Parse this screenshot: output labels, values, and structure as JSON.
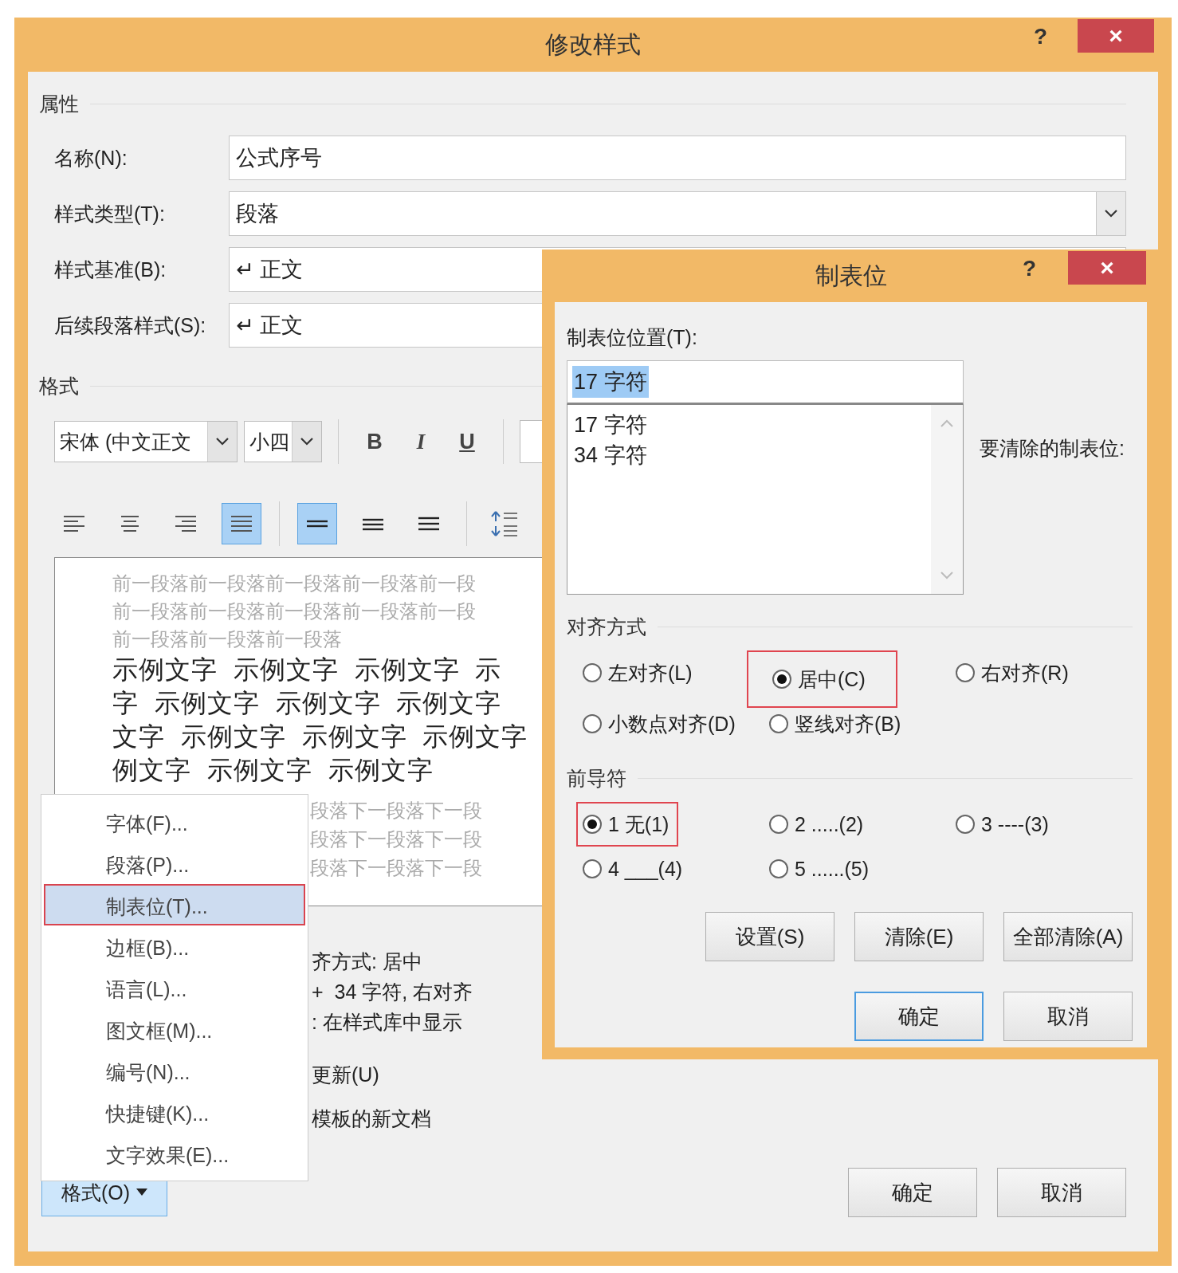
{
  "window": {
    "title": "修改样式",
    "help": "?",
    "close": "×"
  },
  "properties": {
    "heading": "属性",
    "fields": [
      {
        "label": "名称(N):",
        "value": "公式序号",
        "kind": "text"
      },
      {
        "label": "样式类型(T):",
        "value": "段落",
        "kind": "dropdown"
      },
      {
        "label": "样式基准(B):",
        "value": "↵ 正文",
        "kind": "text"
      },
      {
        "label": "后续段落样式(S):",
        "value": "↵ 正文",
        "kind": "text"
      }
    ]
  },
  "format": {
    "heading": "格式",
    "font": "宋体 (中文正文",
    "size": "小四",
    "styles": [
      {
        "label": "B",
        "kind": "bold"
      },
      {
        "label": "I",
        "kind": "italic"
      },
      {
        "label": "U",
        "kind": "underline"
      }
    ],
    "alignment": [
      {
        "kind": "left",
        "selected": false
      },
      {
        "kind": "center",
        "selected": false
      },
      {
        "kind": "right",
        "selected": false
      },
      {
        "kind": "justify",
        "selected": true
      }
    ],
    "spacing": [
      {
        "kind": "single",
        "selected": true
      },
      {
        "kind": "onehalf",
        "selected": false
      },
      {
        "kind": "double",
        "selected": false
      }
    ]
  },
  "preview": {
    "before": [
      "前一段落前一段落前一段落前一段落前一段",
      "前一段落前一段落前一段落前一段落前一段",
      "前一段落前一段落前一段落"
    ],
    "sample": [
      "示例文字  示例文字  示例文字  示",
      "字  示例文字  示例文字  示例文字",
      "文字  示例文字  示例文字  示例文字",
      "例文字  示例文字  示例文字"
    ],
    "after": [
      "段落下一段落下一段",
      "段落下一段落下一段",
      "段落下一段落下一段"
    ]
  },
  "description": [
    "齐方式: 居中",
    "+  34 字符, 右对齐",
    ": 在样式库中显示"
  ],
  "options": [
    "更新(U)",
    "模板的新文档"
  ],
  "format_button": {
    "label": "格式(O)",
    "pressed": true
  },
  "buttons": [
    {
      "label": "确定"
    },
    {
      "label": "取消"
    }
  ],
  "format_menu": [
    {
      "label": "字体(F)...",
      "selected": false
    },
    {
      "label": "段落(P)...",
      "selected": false
    },
    {
      "label": "制表位(T)...",
      "selected": true
    },
    {
      "label": "边框(B)...",
      "selected": false
    },
    {
      "label": "语言(L)...",
      "selected": false
    },
    {
      "label": "图文框(M)...",
      "selected": false
    },
    {
      "label": "编号(N)...",
      "selected": false
    },
    {
      "label": "快捷键(K)...",
      "selected": false
    },
    {
      "label": "文字效果(E)...",
      "selected": false
    }
  ],
  "tabs_dialog": {
    "title": "制表位",
    "help": "?",
    "close": "×",
    "position_label": "制表位位置(T):",
    "position_value": "17 字符",
    "value_selected": true,
    "positions": [
      "17 字符",
      "34 字符"
    ],
    "clear_label": "要清除的制表位:",
    "alignment_heading": "对齐方式",
    "alignment": [
      {
        "label": "左对齐(L)",
        "selected": false,
        "highlighted": false
      },
      {
        "label": "居中(C)",
        "selected": true,
        "highlighted": true
      },
      {
        "label": "右对齐(R)",
        "selected": false,
        "highlighted": false
      },
      {
        "label": "小数点对齐(D)",
        "selected": false,
        "highlighted": false
      },
      {
        "label": "竖线对齐(B)",
        "selected": false,
        "highlighted": false
      }
    ],
    "leader_heading": "前导符",
    "leaders": [
      {
        "label": "1 无(1)",
        "selected": true,
        "highlighted": true
      },
      {
        "label": "2 .....(2)",
        "selected": false,
        "highlighted": false
      },
      {
        "label": "3 ----(3)",
        "selected": false,
        "highlighted": false
      },
      {
        "label": "4 ___(4)",
        "selected": false,
        "highlighted": false
      },
      {
        "label": "5 ......(5)",
        "selected": false,
        "highlighted": false
      }
    ],
    "actions": [
      {
        "label": "设置(S)"
      },
      {
        "label": "清除(E)"
      },
      {
        "label": "全部清除(A)"
      }
    ],
    "buttons": [
      {
        "label": "确定",
        "default": true
      },
      {
        "label": "取消",
        "default": false
      }
    ]
  }
}
